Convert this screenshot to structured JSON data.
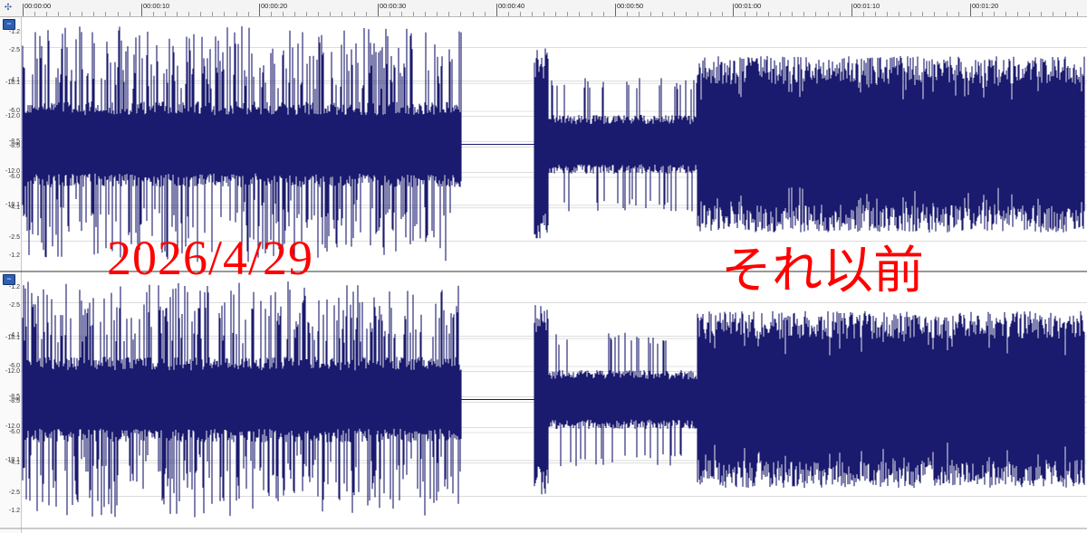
{
  "timeline": {
    "labels": [
      "00:00:00",
      "00:00:10",
      "00:00:20",
      "00:00:30",
      "00:00:40",
      "00:00:50",
      "00:01:00",
      "00:01:10",
      "00:01:20"
    ],
    "icon": "timeline-cursor-icon"
  },
  "db_scale": {
    "labels": [
      "-1.2",
      "-2.5",
      "-4.1",
      "-6.0",
      "-8.5",
      "-12.0",
      "-18.1",
      "-∞",
      "-18.1",
      "-12.0",
      "-8.5",
      "-6.0",
      "-4.1",
      "-2.5",
      "-1.2"
    ]
  },
  "channels": [
    {
      "collapse_label": "−",
      "icon": "collapse-icon"
    },
    {
      "collapse_label": "−",
      "icon": "collapse-icon"
    }
  ],
  "overlay": {
    "left_text": "2026/4/29",
    "right_text": "それ以前"
  },
  "colors": {
    "waveform": "#1a1a6e",
    "overlay_text": "#ff0000",
    "gridline": "#c8c8c8"
  }
}
